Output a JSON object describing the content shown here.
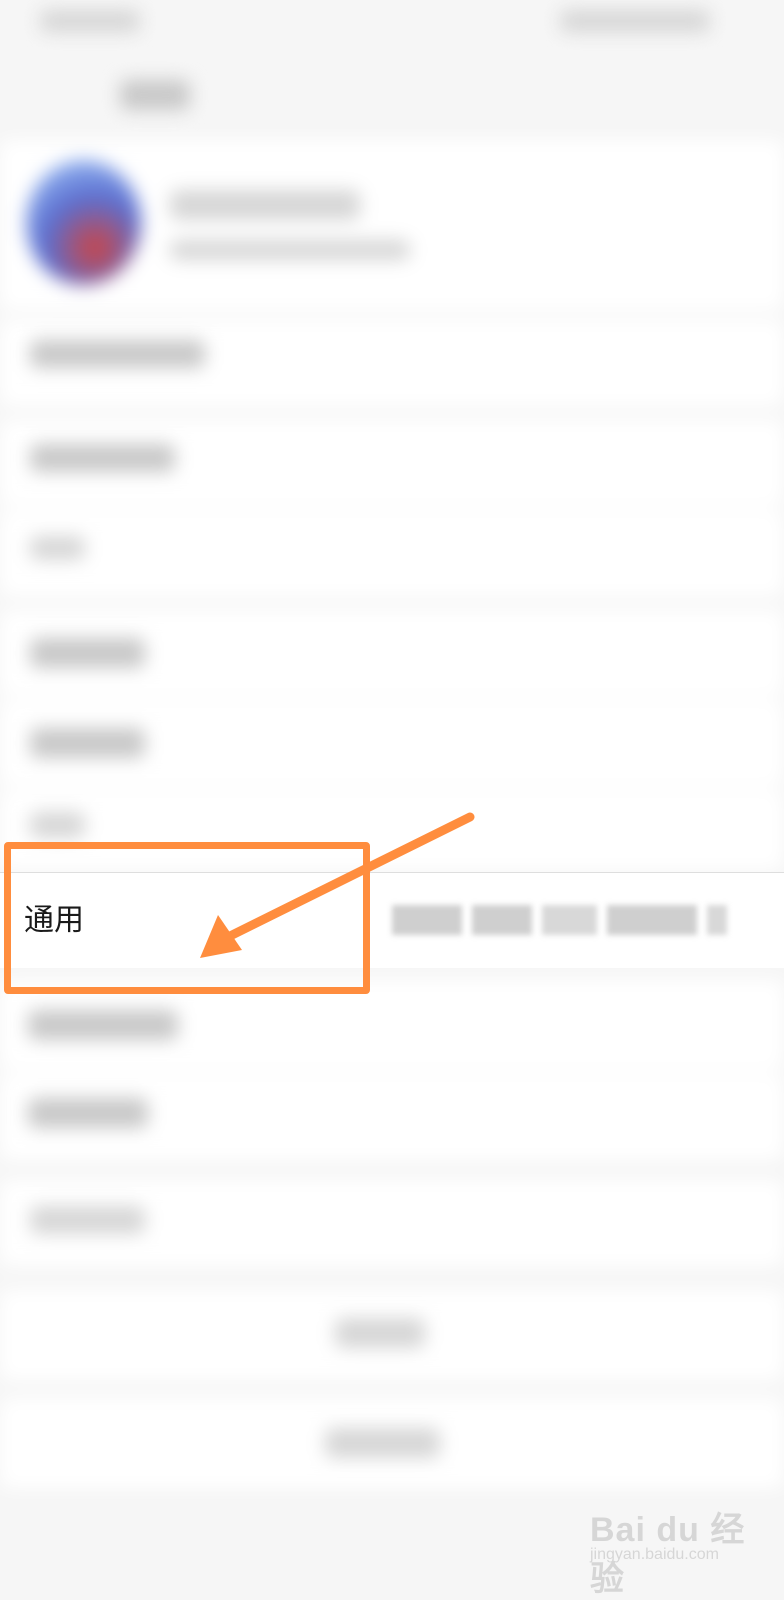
{
  "settings": {
    "general_item": {
      "label": "通用",
      "icon": "chevron-right-icon"
    }
  },
  "annotation": {
    "color": "#ff8d3e"
  },
  "watermark": {
    "logo": "Bai du 经验",
    "sub": "jingyan.baidu.com"
  }
}
